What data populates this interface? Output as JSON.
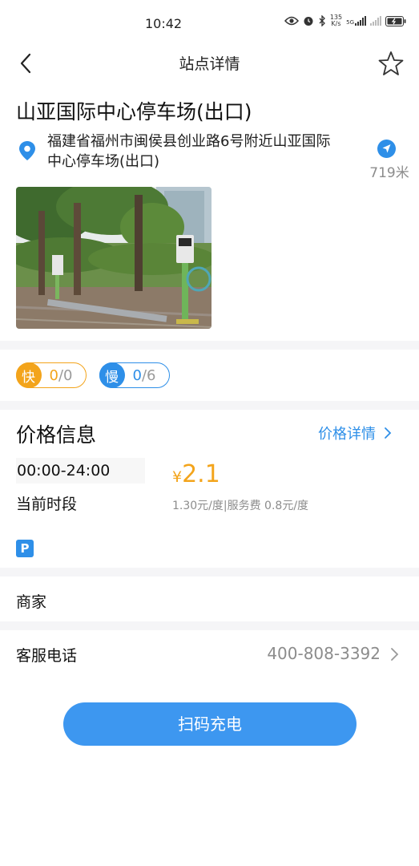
{
  "status_bar": {
    "time": "10:42",
    "net_speed_value": "135",
    "net_speed_unit": "K/s",
    "network_label": "5G"
  },
  "nav": {
    "title": "站点详情"
  },
  "station": {
    "name": "山亚国际中心停车场(出口)",
    "address": "福建省福州市闽侯县创业路6号附近山亚国际中心停车场(出口)",
    "distance": "719米"
  },
  "chargers": {
    "fast": {
      "badge": "快",
      "available": "0",
      "total": "/0",
      "color": "#f3a41b"
    },
    "slow": {
      "badge": "慢",
      "available": "0",
      "total": "/6",
      "color": "#2e8fe8"
    }
  },
  "price_info": {
    "title": "价格信息",
    "detail_link": "价格详情",
    "time_range": "00:00-24:00",
    "current_label": "当前时段",
    "currency": "¥",
    "price": "2.1",
    "breakdown": "1.30元/度|服务费 0.8元/度",
    "parking_badge": "P"
  },
  "merchant": {
    "label": "商家"
  },
  "service_phone": {
    "label": "客服电话",
    "number": "400-808-3392"
  },
  "action": {
    "scan_label": "扫码充电"
  },
  "colors": {
    "accent_blue": "#2e8fe8",
    "accent_orange": "#f3a41b",
    "button_blue": "#3d97f0"
  }
}
